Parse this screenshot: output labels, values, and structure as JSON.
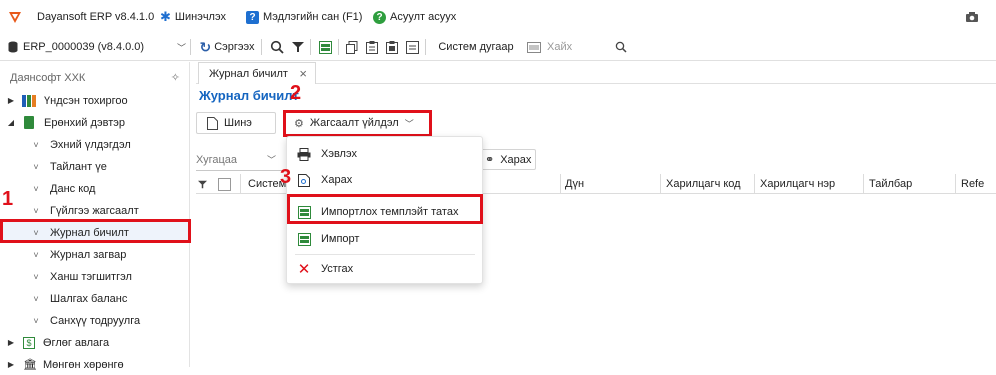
{
  "titlebar": {
    "app_title": "Dayansoft ERP v8.4.1.0",
    "update_label": "Шинэчлэх",
    "knowledge_label": "Мэдлэгийн сан (F1)",
    "qa_label": "Асуулт асуух"
  },
  "toolbar": {
    "db_selector": "ERP_0000039 (v8.4.0.0)",
    "refresh_label": "Сэргээх",
    "system_number_label": "Систем дугаар",
    "search_placeholder": "Хайх"
  },
  "sidebar": {
    "company": "Даянсофт ХХК",
    "items": [
      {
        "label": "Үндсэн тохиргоо"
      },
      {
        "label": "Ерөнхий дэвтэр"
      },
      {
        "label": "Эхний үлдэгдэл"
      },
      {
        "label": "Тайлант үе"
      },
      {
        "label": "Данс код"
      },
      {
        "label": "Гүйлгээ жагсаалт"
      },
      {
        "label": "Журнал бичилт"
      },
      {
        "label": "Журнал загвар"
      },
      {
        "label": "Ханш тэгшитгэл"
      },
      {
        "label": "Шалгах баланс"
      },
      {
        "label": "Санхүү тодруулга"
      },
      {
        "label": "Өглөг авлага"
      },
      {
        "label": "Мөнгөн хөрөнгө"
      }
    ]
  },
  "tab": {
    "label": "Журнал бичилт"
  },
  "page": {
    "title": "Журнал бичилт",
    "new_button": "Шинэ",
    "actions_button": "Жагсаалт үйлдэл",
    "period_placeholder": "Хугацаа",
    "view_button": "Харах"
  },
  "grid": {
    "columns": [
      "Систем",
      "Дүн",
      "Харилцагч код",
      "Харилцагч нэр",
      "Тайлбар",
      "Refe"
    ]
  },
  "dropdown": {
    "items": [
      {
        "label": "Хэвлэх"
      },
      {
        "label": "Харах"
      },
      {
        "label": "Импортлох темплэйт татах"
      },
      {
        "label": "Импорт"
      },
      {
        "label": "Устгах"
      }
    ]
  },
  "annotations": {
    "n1": "1",
    "n2": "2",
    "n3": "3"
  },
  "colors": {
    "accent": "#1565c0",
    "annotation_red": "#e0101a",
    "brand_orange": "#e8591a"
  }
}
